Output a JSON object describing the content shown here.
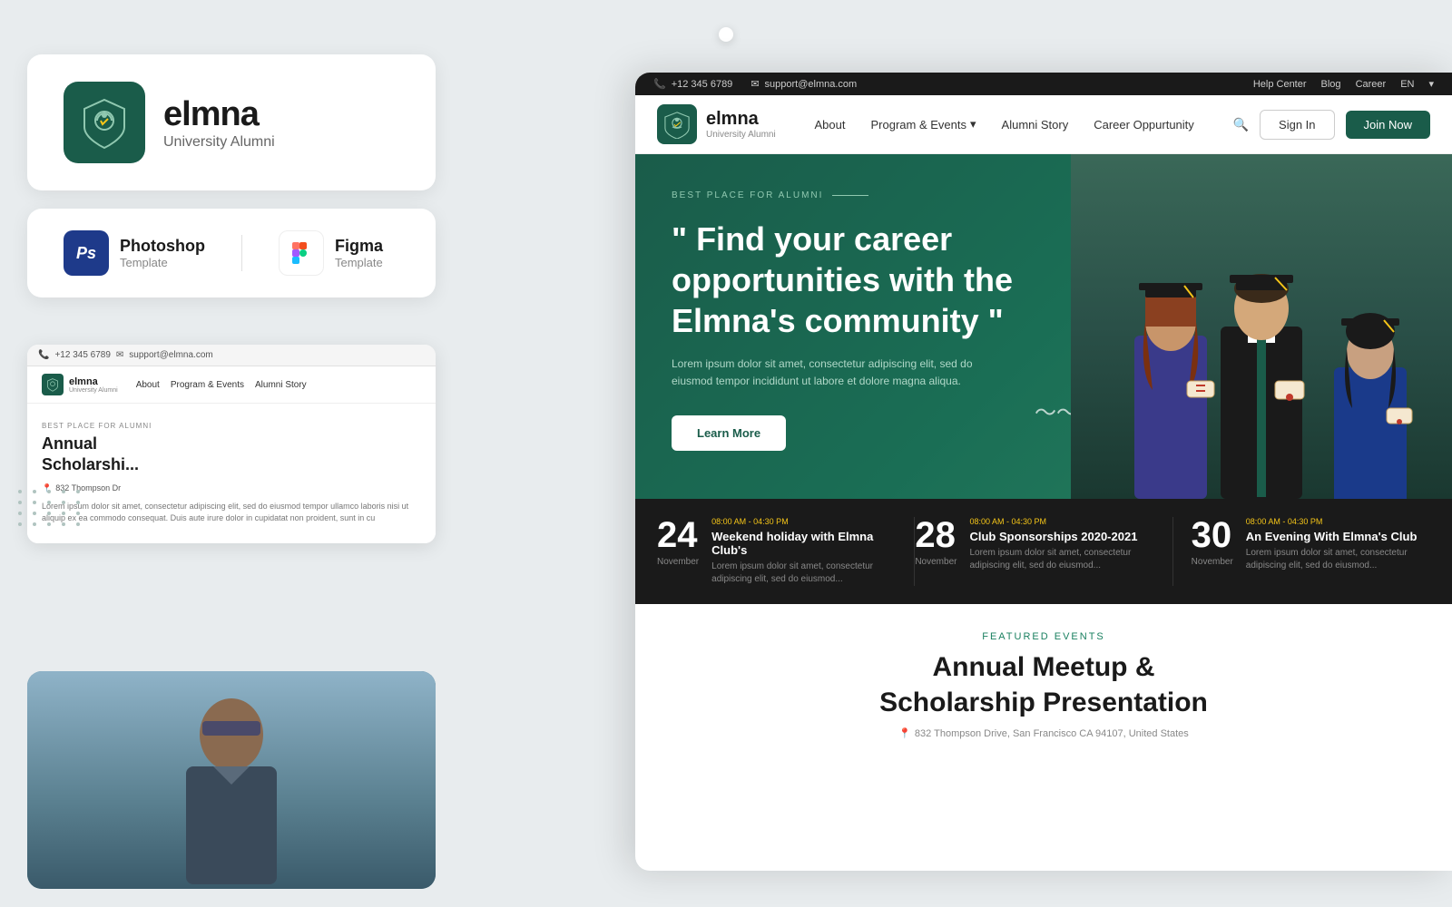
{
  "brand": {
    "name": "elmna",
    "tagline": "University Alumni",
    "shield_icon": "🏛"
  },
  "templates": [
    {
      "type": "Photoshop",
      "label": "Template",
      "abbr": "Ps"
    },
    {
      "type": "Figma",
      "label": "Template",
      "abbr": "F"
    }
  ],
  "infobar": {
    "phone": "+12 345 6789",
    "email": "support@elmna.com",
    "links": [
      "Help Center",
      "Blog",
      "Career"
    ],
    "lang": "EN"
  },
  "navbar": {
    "links": [
      "About",
      "Program & Events",
      "Alumni Story",
      "Career Oppurtunity"
    ],
    "signin": "Sign In",
    "joinnow": "Join Now"
  },
  "hero": {
    "badge": "BEST PLACE FOR ALUMNI",
    "title": "\" Find your career opportunities with the Elmna's community \"",
    "body": "Lorem ipsum dolor sit amet, consectetur adipiscing elit, sed do eiusmod tempor incididunt ut labore et dolore magna aliqua.",
    "cta": "Learn More"
  },
  "events": [
    {
      "day": "24",
      "month": "November",
      "time": "08:00 AM - 04:30 PM",
      "title": "Weekend holiday with Elmna Club's",
      "desc": "Lorem ipsum dolor sit amet, consectetur adipiscing elit, sed do eiusmod..."
    },
    {
      "day": "28",
      "month": "November",
      "time": "08:00 AM - 04:30 PM",
      "title": "Club Sponsorships 2020-2021",
      "desc": "Lorem ipsum dolor sit amet, consectetur adipiscing elit, sed do eiusmod..."
    },
    {
      "day": "30",
      "month": "November",
      "time": "08:00 AM - 04:30 PM",
      "title": "An Evening With Elmna's Club",
      "desc": "Lorem ipsum dolor sit amet, consectetur adipiscing elit, sed do eiusmod..."
    }
  ],
  "featured": {
    "label": "FEATURED EVENTS",
    "title": "Annual Meetup &\nScholarship Presentation",
    "address": "832 Thompson Drive, San Francisco CA 94107, United States"
  },
  "small_browser": {
    "phone": "+12 345 6789",
    "email": "support@elmna.com",
    "nav_links": [
      "About",
      "Program & Events",
      "Alumni Story"
    ],
    "section_title": "Annua\nScholarshi",
    "subtitle_label": "BEST PLACE FOR ALUMNI",
    "address": "832 Thompson Dr",
    "body_text": "Lorem ipsum dolor sit amet, consectetur adipiscing elit, sed do eiusmod tempor ullamco laboris nisi ut aliquip ex ea commodo consequat. Duis aute irure dolor in cupidatat non proident, sunt in cu"
  }
}
